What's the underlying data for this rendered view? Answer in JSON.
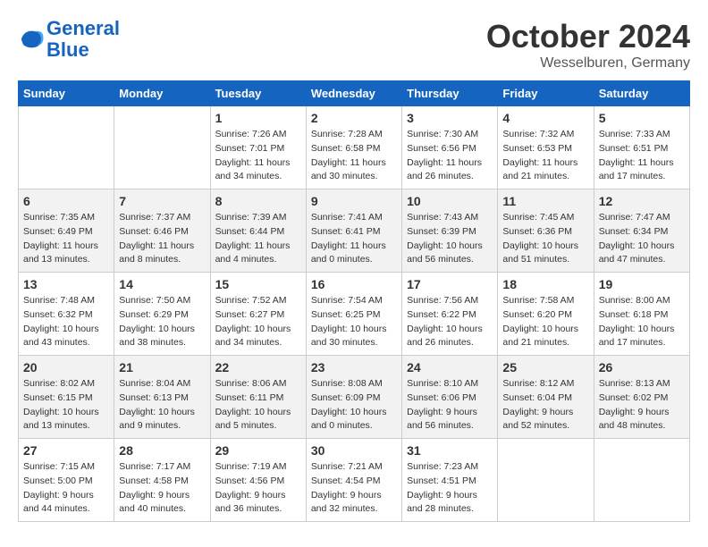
{
  "logo": {
    "line1": "General",
    "line2": "Blue"
  },
  "title": "October 2024",
  "location": "Wesselburen, Germany",
  "days_of_week": [
    "Sunday",
    "Monday",
    "Tuesday",
    "Wednesday",
    "Thursday",
    "Friday",
    "Saturday"
  ],
  "weeks": [
    [
      {
        "day": "",
        "empty": true
      },
      {
        "day": "",
        "empty": true
      },
      {
        "day": "1",
        "sunrise": "Sunrise: 7:26 AM",
        "sunset": "Sunset: 7:01 PM",
        "daylight": "Daylight: 11 hours and 34 minutes."
      },
      {
        "day": "2",
        "sunrise": "Sunrise: 7:28 AM",
        "sunset": "Sunset: 6:58 PM",
        "daylight": "Daylight: 11 hours and 30 minutes."
      },
      {
        "day": "3",
        "sunrise": "Sunrise: 7:30 AM",
        "sunset": "Sunset: 6:56 PM",
        "daylight": "Daylight: 11 hours and 26 minutes."
      },
      {
        "day": "4",
        "sunrise": "Sunrise: 7:32 AM",
        "sunset": "Sunset: 6:53 PM",
        "daylight": "Daylight: 11 hours and 21 minutes."
      },
      {
        "day": "5",
        "sunrise": "Sunrise: 7:33 AM",
        "sunset": "Sunset: 6:51 PM",
        "daylight": "Daylight: 11 hours and 17 minutes."
      }
    ],
    [
      {
        "day": "6",
        "sunrise": "Sunrise: 7:35 AM",
        "sunset": "Sunset: 6:49 PM",
        "daylight": "Daylight: 11 hours and 13 minutes."
      },
      {
        "day": "7",
        "sunrise": "Sunrise: 7:37 AM",
        "sunset": "Sunset: 6:46 PM",
        "daylight": "Daylight: 11 hours and 8 minutes."
      },
      {
        "day": "8",
        "sunrise": "Sunrise: 7:39 AM",
        "sunset": "Sunset: 6:44 PM",
        "daylight": "Daylight: 11 hours and 4 minutes."
      },
      {
        "day": "9",
        "sunrise": "Sunrise: 7:41 AM",
        "sunset": "Sunset: 6:41 PM",
        "daylight": "Daylight: 11 hours and 0 minutes."
      },
      {
        "day": "10",
        "sunrise": "Sunrise: 7:43 AM",
        "sunset": "Sunset: 6:39 PM",
        "daylight": "Daylight: 10 hours and 56 minutes."
      },
      {
        "day": "11",
        "sunrise": "Sunrise: 7:45 AM",
        "sunset": "Sunset: 6:36 PM",
        "daylight": "Daylight: 10 hours and 51 minutes."
      },
      {
        "day": "12",
        "sunrise": "Sunrise: 7:47 AM",
        "sunset": "Sunset: 6:34 PM",
        "daylight": "Daylight: 10 hours and 47 minutes."
      }
    ],
    [
      {
        "day": "13",
        "sunrise": "Sunrise: 7:48 AM",
        "sunset": "Sunset: 6:32 PM",
        "daylight": "Daylight: 10 hours and 43 minutes."
      },
      {
        "day": "14",
        "sunrise": "Sunrise: 7:50 AM",
        "sunset": "Sunset: 6:29 PM",
        "daylight": "Daylight: 10 hours and 38 minutes."
      },
      {
        "day": "15",
        "sunrise": "Sunrise: 7:52 AM",
        "sunset": "Sunset: 6:27 PM",
        "daylight": "Daylight: 10 hours and 34 minutes."
      },
      {
        "day": "16",
        "sunrise": "Sunrise: 7:54 AM",
        "sunset": "Sunset: 6:25 PM",
        "daylight": "Daylight: 10 hours and 30 minutes."
      },
      {
        "day": "17",
        "sunrise": "Sunrise: 7:56 AM",
        "sunset": "Sunset: 6:22 PM",
        "daylight": "Daylight: 10 hours and 26 minutes."
      },
      {
        "day": "18",
        "sunrise": "Sunrise: 7:58 AM",
        "sunset": "Sunset: 6:20 PM",
        "daylight": "Daylight: 10 hours and 21 minutes."
      },
      {
        "day": "19",
        "sunrise": "Sunrise: 8:00 AM",
        "sunset": "Sunset: 6:18 PM",
        "daylight": "Daylight: 10 hours and 17 minutes."
      }
    ],
    [
      {
        "day": "20",
        "sunrise": "Sunrise: 8:02 AM",
        "sunset": "Sunset: 6:15 PM",
        "daylight": "Daylight: 10 hours and 13 minutes."
      },
      {
        "day": "21",
        "sunrise": "Sunrise: 8:04 AM",
        "sunset": "Sunset: 6:13 PM",
        "daylight": "Daylight: 10 hours and 9 minutes."
      },
      {
        "day": "22",
        "sunrise": "Sunrise: 8:06 AM",
        "sunset": "Sunset: 6:11 PM",
        "daylight": "Daylight: 10 hours and 5 minutes."
      },
      {
        "day": "23",
        "sunrise": "Sunrise: 8:08 AM",
        "sunset": "Sunset: 6:09 PM",
        "daylight": "Daylight: 10 hours and 0 minutes."
      },
      {
        "day": "24",
        "sunrise": "Sunrise: 8:10 AM",
        "sunset": "Sunset: 6:06 PM",
        "daylight": "Daylight: 9 hours and 56 minutes."
      },
      {
        "day": "25",
        "sunrise": "Sunrise: 8:12 AM",
        "sunset": "Sunset: 6:04 PM",
        "daylight": "Daylight: 9 hours and 52 minutes."
      },
      {
        "day": "26",
        "sunrise": "Sunrise: 8:13 AM",
        "sunset": "Sunset: 6:02 PM",
        "daylight": "Daylight: 9 hours and 48 minutes."
      }
    ],
    [
      {
        "day": "27",
        "sunrise": "Sunrise: 7:15 AM",
        "sunset": "Sunset: 5:00 PM",
        "daylight": "Daylight: 9 hours and 44 minutes."
      },
      {
        "day": "28",
        "sunrise": "Sunrise: 7:17 AM",
        "sunset": "Sunset: 4:58 PM",
        "daylight": "Daylight: 9 hours and 40 minutes."
      },
      {
        "day": "29",
        "sunrise": "Sunrise: 7:19 AM",
        "sunset": "Sunset: 4:56 PM",
        "daylight": "Daylight: 9 hours and 36 minutes."
      },
      {
        "day": "30",
        "sunrise": "Sunrise: 7:21 AM",
        "sunset": "Sunset: 4:54 PM",
        "daylight": "Daylight: 9 hours and 32 minutes."
      },
      {
        "day": "31",
        "sunrise": "Sunrise: 7:23 AM",
        "sunset": "Sunset: 4:51 PM",
        "daylight": "Daylight: 9 hours and 28 minutes."
      },
      {
        "day": "",
        "empty": true
      },
      {
        "day": "",
        "empty": true
      }
    ]
  ]
}
